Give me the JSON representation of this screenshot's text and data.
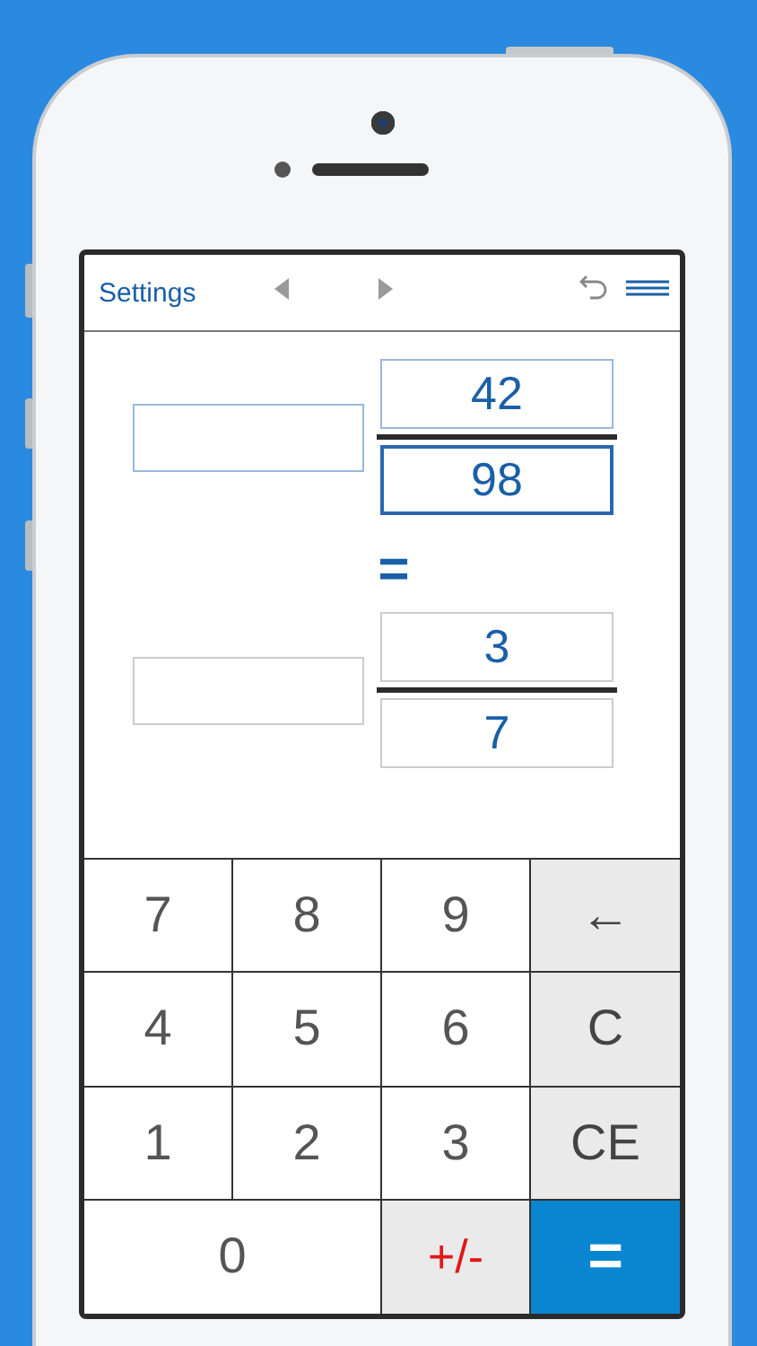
{
  "header": {
    "settings": "Settings"
  },
  "fractions": [
    {
      "active": true,
      "whole": {
        "focused": false
      },
      "numerator": {
        "value": "42",
        "focused": false
      },
      "denominator": {
        "value": "98",
        "focused": true
      }
    },
    {
      "active": false,
      "whole": {
        "focused": false
      },
      "numerator": {
        "value": "3",
        "focused": false
      },
      "denominator": {
        "value": "7",
        "focused": false
      }
    }
  ],
  "equals_sign": "=",
  "keys": [
    {
      "label": "7",
      "kind": "digit"
    },
    {
      "label": "8",
      "kind": "digit"
    },
    {
      "label": "9",
      "kind": "digit"
    },
    {
      "label": "←",
      "kind": "function"
    },
    {
      "label": "4",
      "kind": "digit"
    },
    {
      "label": "5",
      "kind": "digit"
    },
    {
      "label": "6",
      "kind": "digit"
    },
    {
      "label": "C",
      "kind": "function"
    },
    {
      "label": "1",
      "kind": "digit"
    },
    {
      "label": "2",
      "kind": "digit"
    },
    {
      "label": "3",
      "kind": "digit"
    },
    {
      "label": "CE",
      "kind": "function"
    },
    {
      "label": "0",
      "kind": "wide"
    },
    {
      "label": "+/-",
      "kind": "sign"
    },
    {
      "label": "=",
      "kind": "equals"
    }
  ]
}
